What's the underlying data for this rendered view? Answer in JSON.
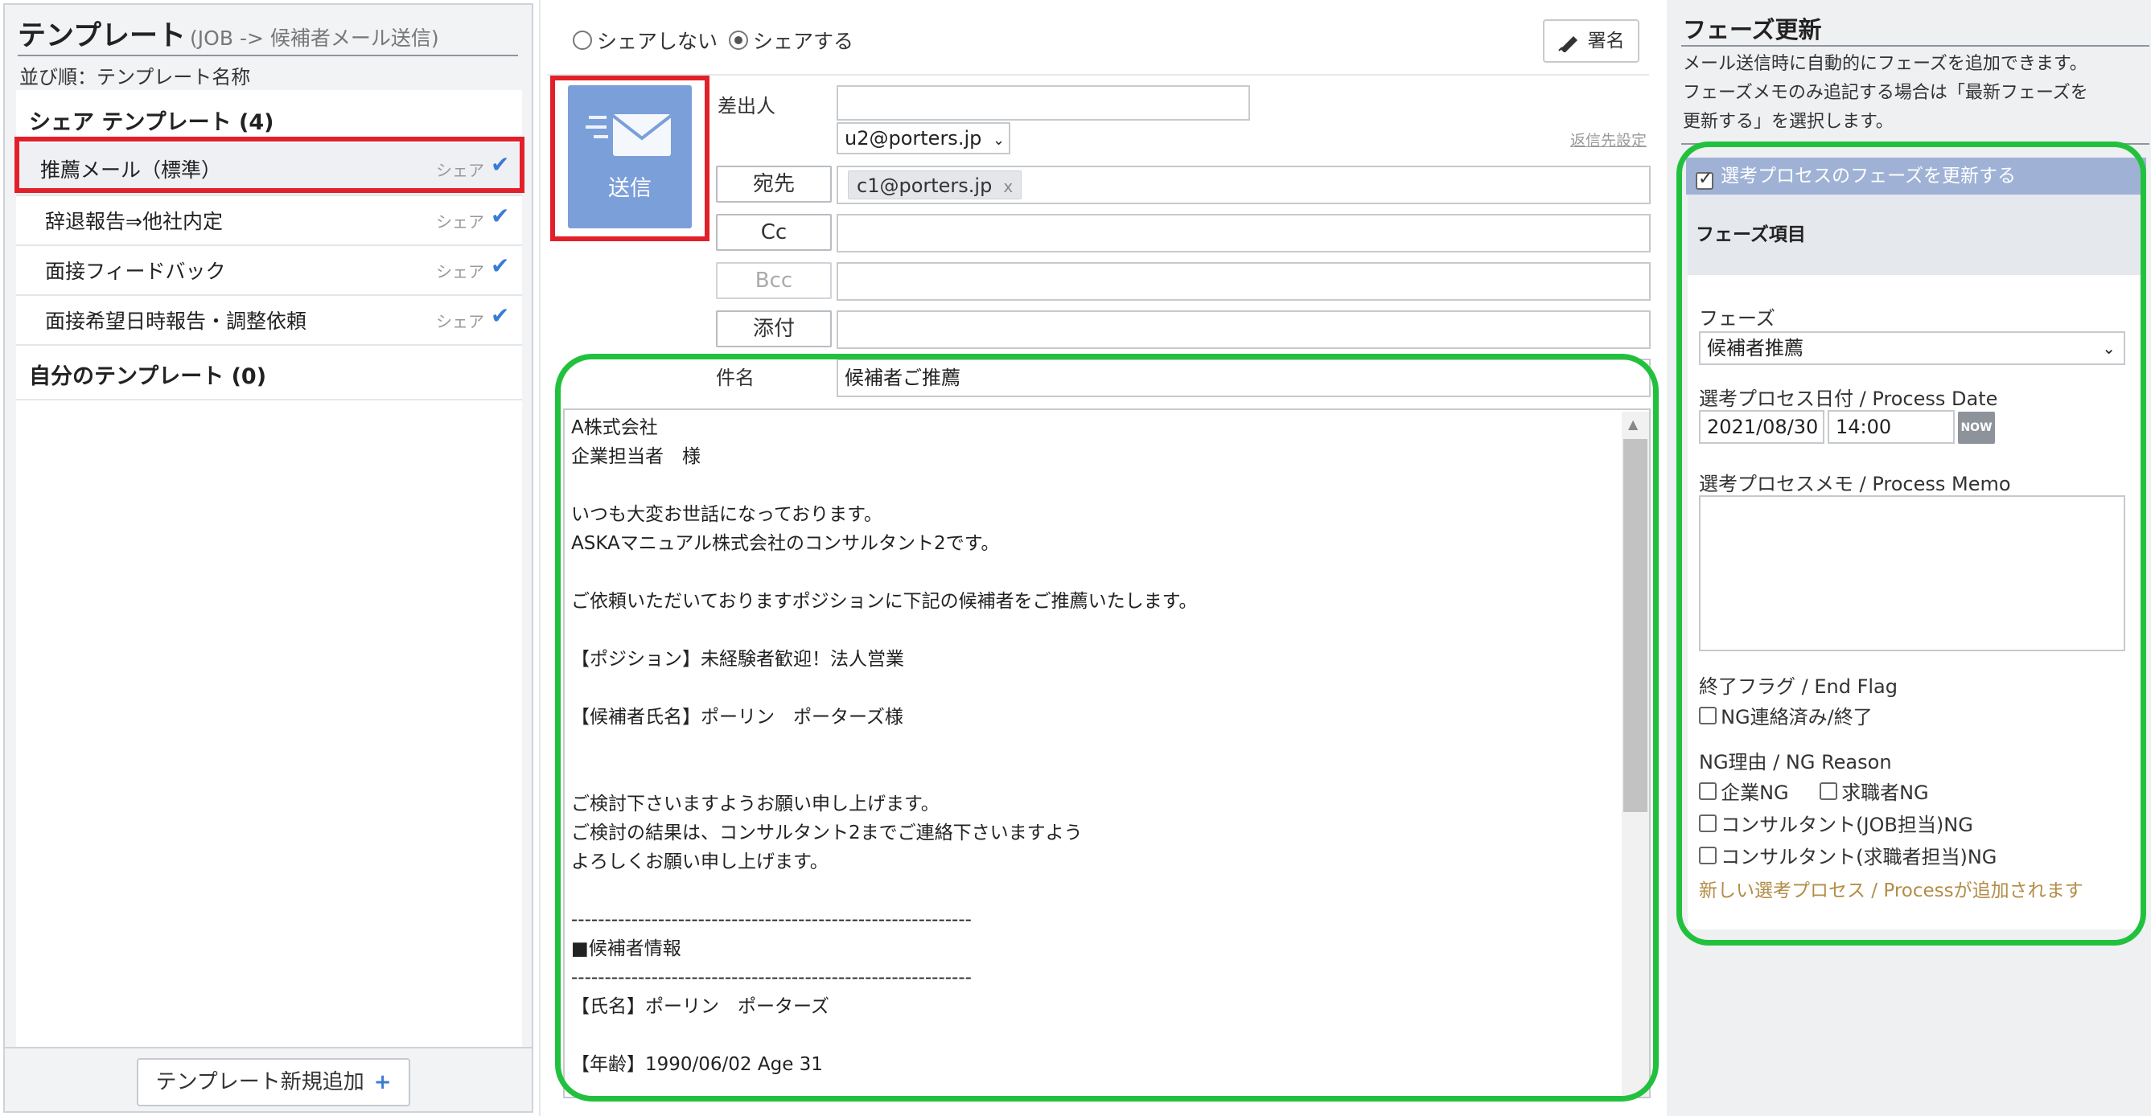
{
  "left_panel": {
    "title": "テンプレート",
    "subtitle": "(JOB -> 候補者メール送信)",
    "sort_label": "並び順：テンプレート名称",
    "shared_section": "シェア テンプレート (4)",
    "templates": [
      {
        "name": "推薦メール（標準）",
        "share": "シェア"
      },
      {
        "name": "辞退報告⇒他社内定",
        "share": "シェア"
      },
      {
        "name": "面接フィードバック",
        "share": "シェア"
      },
      {
        "name": "面接希望日時報告・調整依頼",
        "share": "シェア"
      }
    ],
    "own_section": "自分のテンプレート (0)",
    "add_button": "テンプレート新規追加",
    "add_plus": "+"
  },
  "composer": {
    "share_options": [
      "シェアしない",
      "シェアする"
    ],
    "selected_share": "シェアする",
    "signature_button": "署名",
    "send_button": "送信",
    "from_label": "差出人",
    "from_value": "",
    "from_select": "u2@porters.jp",
    "reply_link": "返信先設定",
    "to_button": "宛先",
    "to_recipients": [
      "c1@porters.jp"
    ],
    "cc_button": "Cc",
    "bcc_button": "Bcc",
    "attach_button": "添付",
    "subject_label": "件名",
    "subject_value": "候補者ご推薦",
    "body": "A株式会社\n企業担当者　様\n\nいつも大変お世話になっております。\nASKAマニュアル株式会社のコンサルタント2です。\n\nご依頼いただいておりますポジションに下記の候補者をご推薦いたします。\n\n【ポジション】未経験者歓迎！法人営業\n\n【候補者氏名】ポーリン　ポーターズ様\n\n\nご検討下さいますようお願い申し上げます。\nご検討の結果は、コンサルタント2までご連絡下さいますよう\nよろしくお願い申し上げます。\n\n------------------------------------------------------------\n■候補者情報\n------------------------------------------------------------\n【氏名】ポーリン　ポーターズ\n\n【年齢】1990/06/02 Age 31"
  },
  "phase_panel": {
    "title": "フェーズ更新",
    "description": "メール送信時に自動的にフェーズを追加できます。\nフェーズメモのみ追記する場合は「最新フェーズを\n更新する」を選択します。",
    "update_checkbox": "選考プロセスのフェーズを更新する",
    "phase_items_label": "フェーズ項目",
    "phase_label": "フェーズ",
    "phase_value": "候補者推薦",
    "date_label": "選考プロセス日付 / Process Date",
    "date_value": "2021/08/30",
    "time_value": "14:00",
    "now_button": "NOW",
    "memo_label": "選考プロセスメモ / Process Memo",
    "memo_value": "",
    "end_flag_label": "終了フラグ / End Flag",
    "end_flag_option": "NG連絡済み/終了",
    "ng_reason_label": "NG理由 / NG Reason",
    "ng_options": [
      "企業NG",
      "求職者NG",
      "コンサルタント(JOB担当)NG",
      "コンサルタント(求職者担当)NG"
    ],
    "note": "新しい選考プロセス / Processが追加されます"
  },
  "colors": {
    "send_button": "#7b9fd9",
    "highlight_red": "#e2202a",
    "highlight_green": "#22c13d",
    "check_blue": "#3b7bd6",
    "update_bar": "#9fb2d6",
    "note_gold": "#b38c47"
  },
  "icons": {
    "send": "envelope-icon",
    "signature": "pen-icon",
    "share_check": "checkmark-icon",
    "select": "chevron-down-icon",
    "remove": "close-icon"
  }
}
